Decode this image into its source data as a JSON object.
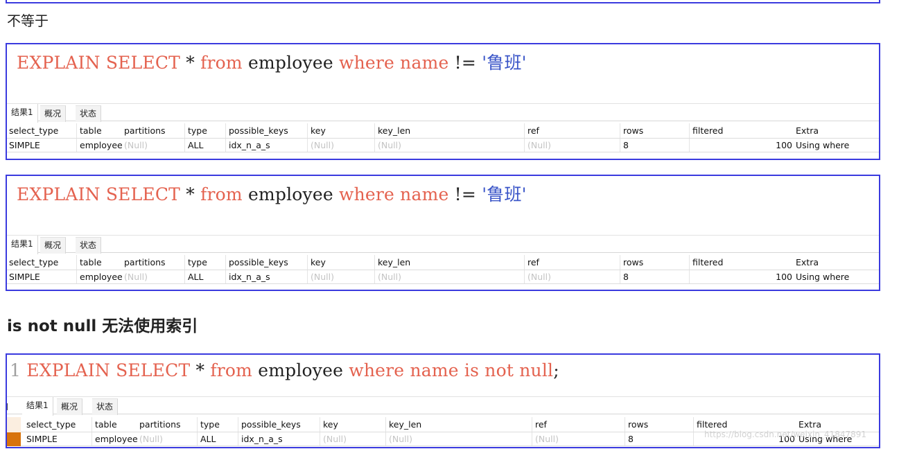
{
  "section1": {
    "heading": "不等于"
  },
  "section2": {
    "heading": "is not null 无法使用索引"
  },
  "tabs": [
    "结果1",
    "概况",
    "状态"
  ],
  "columns": [
    "select_type",
    "table",
    "partitions",
    "type",
    "possible_keys",
    "key",
    "key_len",
    "ref",
    "rows",
    "filtered",
    "Extra"
  ],
  "query1": {
    "t1": "EXPLAIN SELECT",
    "t2": " * ",
    "t3": "from",
    "t4": " employee ",
    "t5": "where name",
    "t6": " != ",
    "t7": "'鲁班'"
  },
  "query3": {
    "line": "1",
    "t1": "EXPLAIN SELECT",
    "t2": " * ",
    "t3": "from",
    "t4": " employee ",
    "t5": "where name is not null",
    "t6": ";"
  },
  "row": {
    "select_type": "SIMPLE",
    "table": "employee",
    "partitions": "(Null)",
    "type": "ALL",
    "possible_keys": "idx_n_a_s",
    "key": "(Null)",
    "key_len": "(Null)",
    "ref": "(Null)",
    "rows": "8",
    "filtered": "100",
    "extra": "Using where"
  },
  "watermark": "https://blog.csdn.net/weixin_41847891"
}
